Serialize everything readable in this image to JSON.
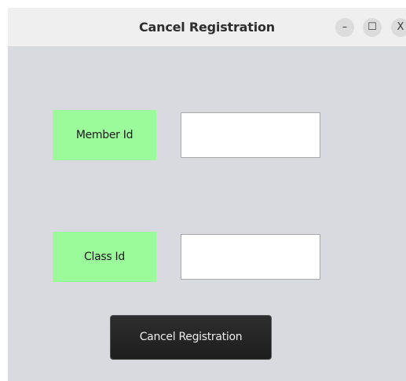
{
  "window": {
    "title": "Cancel Registration",
    "controls": {
      "minimize": "–",
      "maximize": "☐",
      "close": "X"
    }
  },
  "form": {
    "member_id": {
      "label": "Member Id",
      "value": ""
    },
    "class_id": {
      "label": "Class Id",
      "value": ""
    },
    "submit_label": "Cancel Registration"
  },
  "colors": {
    "label_background": "#9bfb9b",
    "window_background": "#d8dae0",
    "button_background": "#222222"
  }
}
